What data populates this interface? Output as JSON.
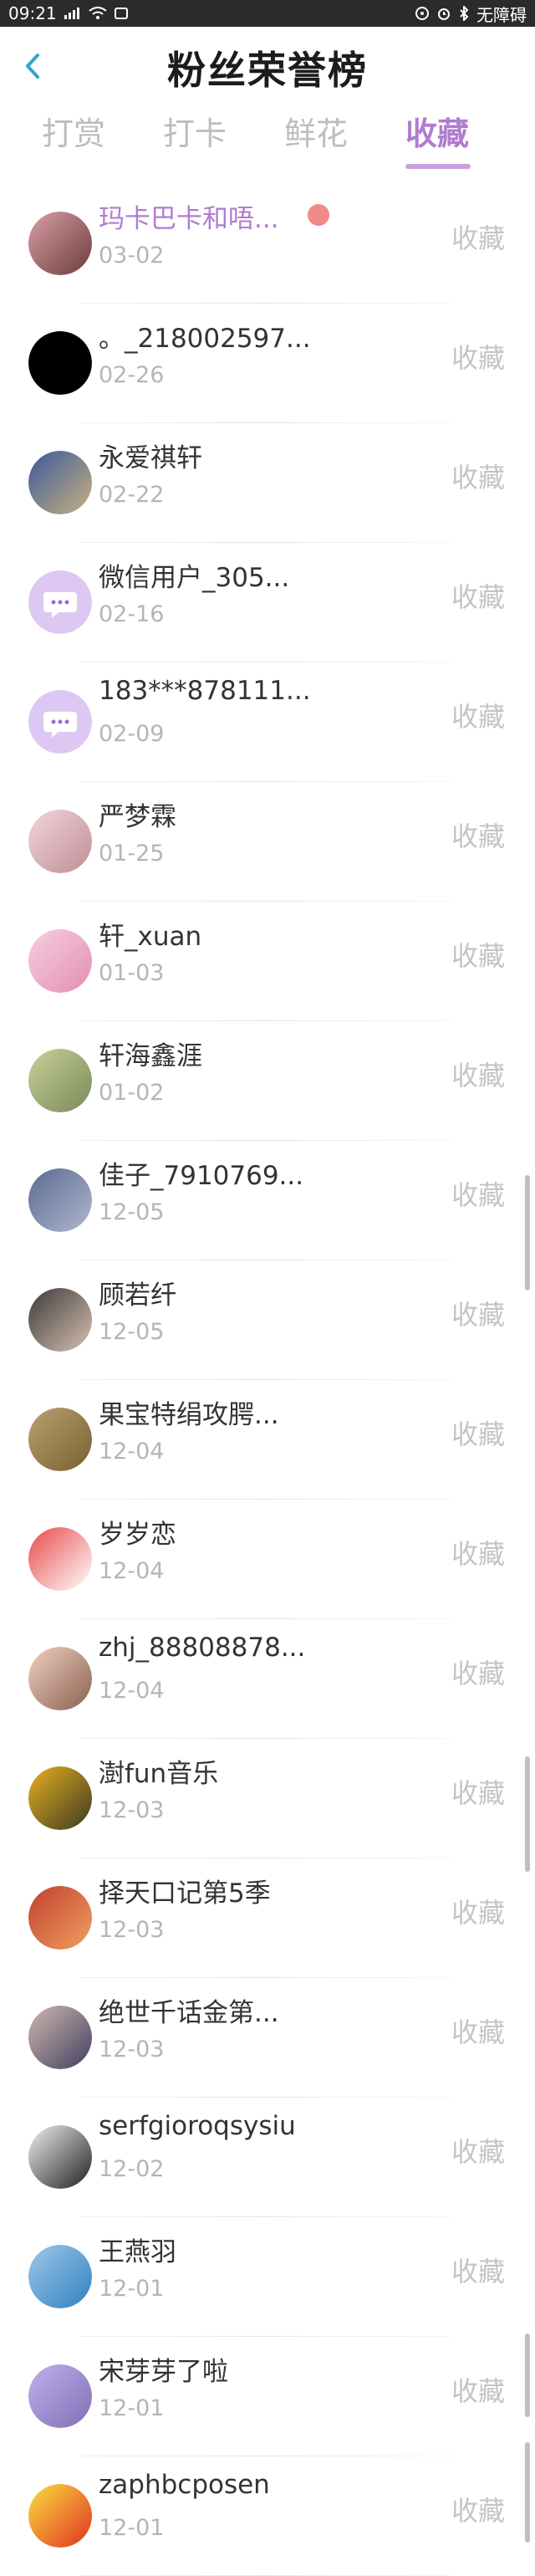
{
  "status_bar": {
    "time": "09:21",
    "right_text": "无障碍"
  },
  "header": {
    "title": "粉丝荣誉榜"
  },
  "tabs": [
    {
      "label": "打赏",
      "active": false
    },
    {
      "label": "打卡",
      "active": false
    },
    {
      "label": "鲜花",
      "active": false
    },
    {
      "label": "收藏",
      "active": true
    }
  ],
  "action_label": "收藏",
  "fans": [
    {
      "name": "玛卡巴卡和唔...",
      "date": "03-02"
    },
    {
      "name": "。_218002597...",
      "date": "02-26"
    },
    {
      "name": "永爱祺轩",
      "date": "02-22"
    },
    {
      "name": "微信用户_305...",
      "date": "02-16"
    },
    {
      "name": "183***878111...",
      "date": "02-09"
    },
    {
      "name": "严梦霖",
      "date": "01-25"
    },
    {
      "name": "轩_xuan",
      "date": "01-03"
    },
    {
      "name": "轩海鑫涯",
      "date": "01-02"
    },
    {
      "name": "佳子_7910769...",
      "date": "12-05"
    },
    {
      "name": "顾若纤",
      "date": "12-05"
    },
    {
      "name": "果宝特绢攻腭...",
      "date": "12-04"
    },
    {
      "name": "岁岁恋",
      "date": "12-04"
    },
    {
      "name": "zhj_88808878...",
      "date": "12-04"
    },
    {
      "name": "澍fun音乐",
      "date": "12-03"
    },
    {
      "name": "择天口记第5季",
      "date": "12-03"
    },
    {
      "name": "绝世千话金第...",
      "date": "12-03"
    },
    {
      "name": "serfgioroqsysiu",
      "date": "12-02"
    },
    {
      "name": "王燕羽",
      "date": "12-01"
    },
    {
      "name": "宋芽芽了啦",
      "date": "12-01"
    },
    {
      "name": "zaphbcposen",
      "date": "12-01"
    }
  ],
  "colors": {
    "accent": "#b07ccf",
    "status_bar": "#2b2b2b"
  }
}
